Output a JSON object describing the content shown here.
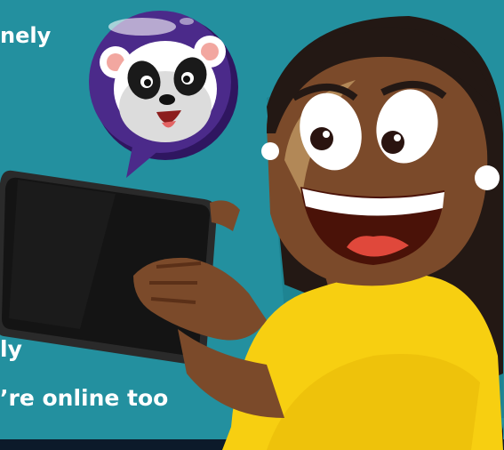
{
  "text": {
    "line_1": "nely",
    "line_2": "ly",
    "line_3": "’re online too"
  },
  "colors": {
    "background": "#23909f",
    "bubble": "#4b2a8a",
    "shirt": "#f7cf11",
    "skin": "#7b4a2a",
    "hair": "#231814",
    "tablet": "#141414"
  },
  "icons": [
    "panda-face-icon"
  ]
}
